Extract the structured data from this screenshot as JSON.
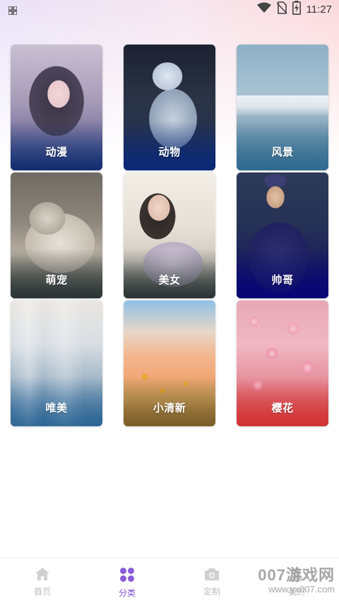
{
  "status_bar": {
    "time": "11:27",
    "icons": [
      "grid-icon",
      "wifi-icon",
      "no-sim-icon",
      "battery-charging-icon"
    ]
  },
  "categories": [
    {
      "label": "动漫"
    },
    {
      "label": "动物"
    },
    {
      "label": "风景"
    },
    {
      "label": "萌宠"
    },
    {
      "label": "美女"
    },
    {
      "label": "帅哥"
    },
    {
      "label": "唯美"
    },
    {
      "label": "小清新"
    },
    {
      "label": "樱花"
    }
  ],
  "bottom_nav": {
    "items": [
      {
        "label": "首页",
        "icon": "home-icon",
        "active": false
      },
      {
        "label": "分类",
        "icon": "category-icon",
        "active": true
      },
      {
        "label": "定制",
        "icon": "camera-icon",
        "active": false
      },
      {
        "label": "我的",
        "icon": "user-icon",
        "active": false
      }
    ],
    "accent_color": "#7b4fd0",
    "inactive_color": "#bdbdbd"
  },
  "watermark": {
    "title": "007游戏网",
    "url": "www.yx007.com"
  }
}
